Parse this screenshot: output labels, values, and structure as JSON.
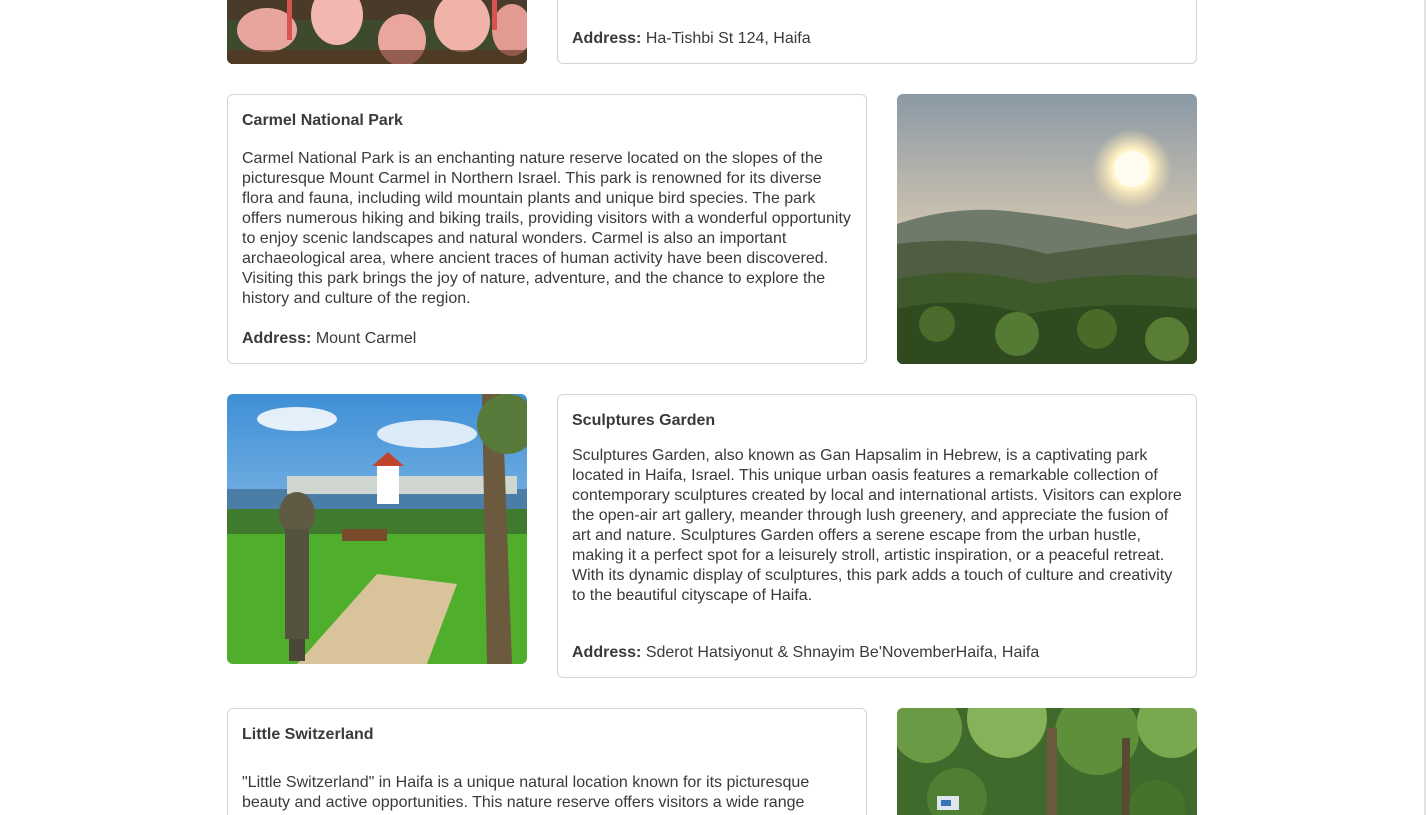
{
  "cards": [
    {
      "id": "top",
      "address_label": "Address:",
      "address": "Ha-Tishbi St 124, Haifa"
    },
    {
      "id": "carmel",
      "title": "Carmel National Park",
      "description": "Carmel National Park is an enchanting nature reserve located on the slopes of the picturesque Mount Carmel in Northern Israel. This park is renowned for its diverse flora and fauna, including wild mountain plants and unique bird species. The park offers numerous hiking and biking trails, providing visitors with a wonderful opportunity to enjoy scenic landscapes and natural wonders. Carmel is also an important archaeological area, where ancient traces of human activity have been discovered. Visiting this park brings the joy of nature, adventure, and the chance to explore the history and culture of the region.",
      "address_label": "Address:",
      "address": "Mount Carmel"
    },
    {
      "id": "sculptures",
      "title": "Sculptures Garden",
      "description": "Sculptures Garden, also known as Gan Hapsalim in Hebrew, is a captivating park located in Haifa, Israel. This unique urban oasis features a remarkable collection of contemporary sculptures created by local and international artists. Visitors can explore the open-air art gallery, meander through lush greenery, and appreciate the fusion of art and nature. Sculptures Garden offers a serene escape from the urban hustle, making it a perfect spot for a leisurely stroll, artistic inspiration, or a peaceful retreat. With its dynamic display of sculptures, this park adds a touch of culture and creativity to the beautiful cityscape of Haifa.",
      "address_label": "Address:",
      "address": "Sderot Hatsiyonut & Shnayim Be'NovemberHaifa, Haifa"
    },
    {
      "id": "switzerland",
      "title": "Little Switzerland",
      "description": "\"Little Switzerland\" in Haifa is a unique natural location known for its picturesque beauty and active opportunities. This nature reserve offers visitors a wide range"
    }
  ]
}
